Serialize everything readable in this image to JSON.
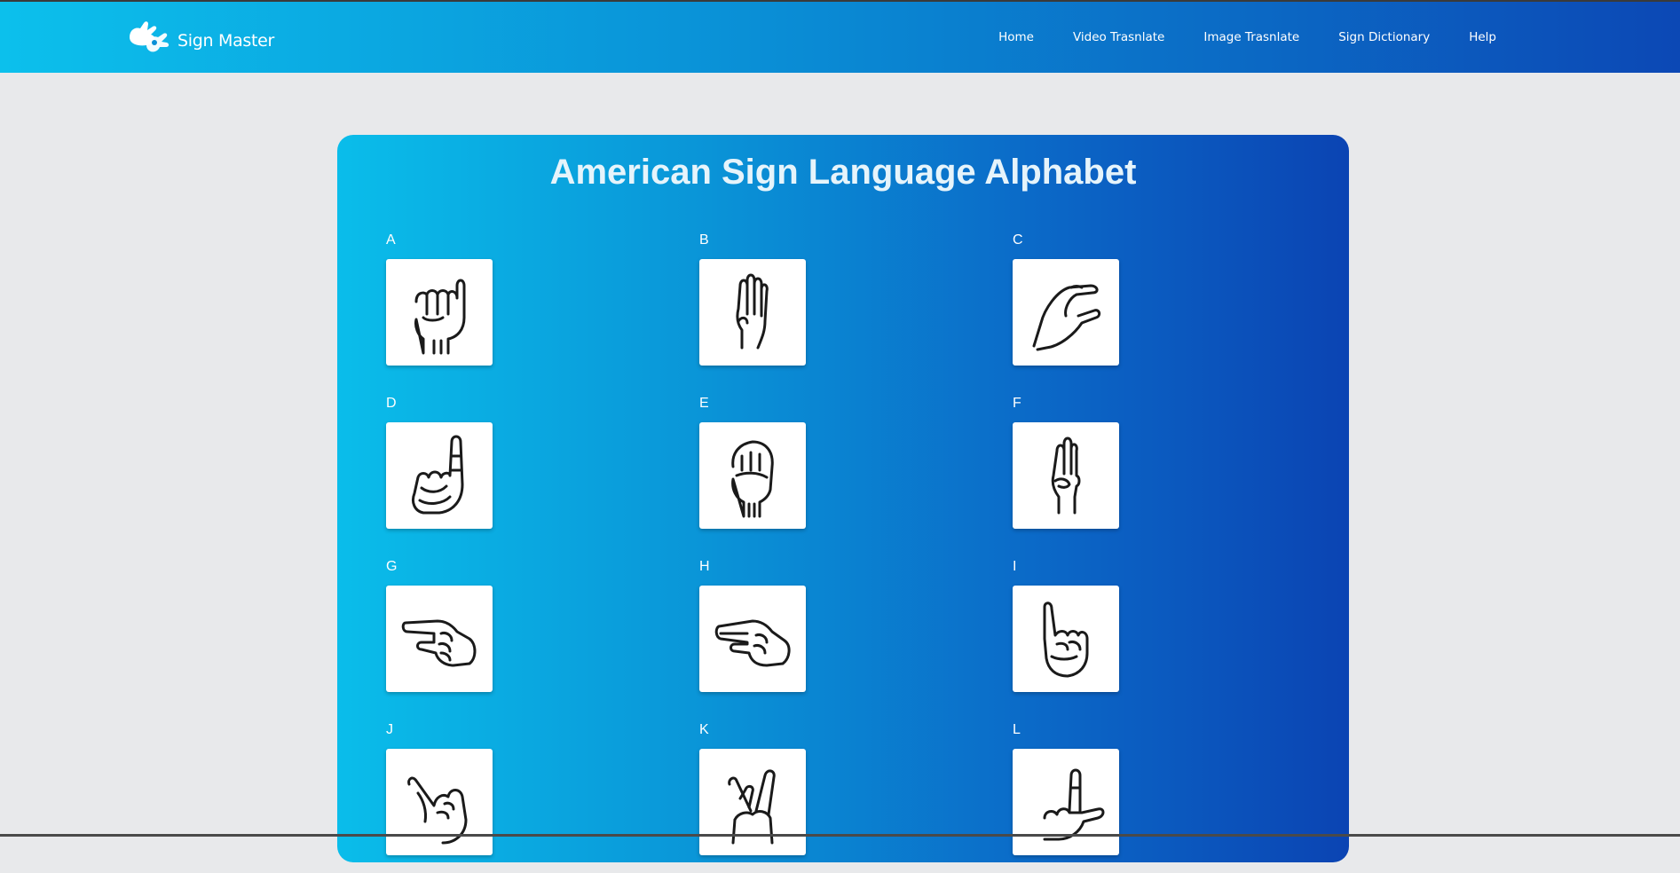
{
  "header": {
    "brand_name": "Sign Master",
    "brand_icon": "hands-logo-icon",
    "nav": [
      {
        "label": "Home"
      },
      {
        "label": "Video Trasnlate"
      },
      {
        "label": "Image Trasnlate"
      },
      {
        "label": "Sign Dictionary"
      },
      {
        "label": "Help"
      }
    ]
  },
  "main": {
    "title": "American Sign Language Alphabet",
    "letters": [
      {
        "letter": "A",
        "icon": "asl-a-hand-icon"
      },
      {
        "letter": "B",
        "icon": "asl-b-hand-icon"
      },
      {
        "letter": "C",
        "icon": "asl-c-hand-icon"
      },
      {
        "letter": "D",
        "icon": "asl-d-hand-icon"
      },
      {
        "letter": "E",
        "icon": "asl-e-hand-icon"
      },
      {
        "letter": "F",
        "icon": "asl-f-hand-icon"
      },
      {
        "letter": "G",
        "icon": "asl-g-hand-icon"
      },
      {
        "letter": "H",
        "icon": "asl-h-hand-icon"
      },
      {
        "letter": "I",
        "icon": "asl-i-hand-icon"
      },
      {
        "letter": "J",
        "icon": "asl-j-hand-icon"
      },
      {
        "letter": "K",
        "icon": "asl-k-hand-icon"
      },
      {
        "letter": "L",
        "icon": "asl-l-hand-icon"
      }
    ]
  },
  "colors": {
    "nav_gradient_start": "#0cc0ec",
    "nav_gradient_end": "#0c48b5",
    "panel_gradient_start": "#0abdea",
    "panel_gradient_end": "#0b44b3",
    "page_background": "#e8e9eb"
  }
}
